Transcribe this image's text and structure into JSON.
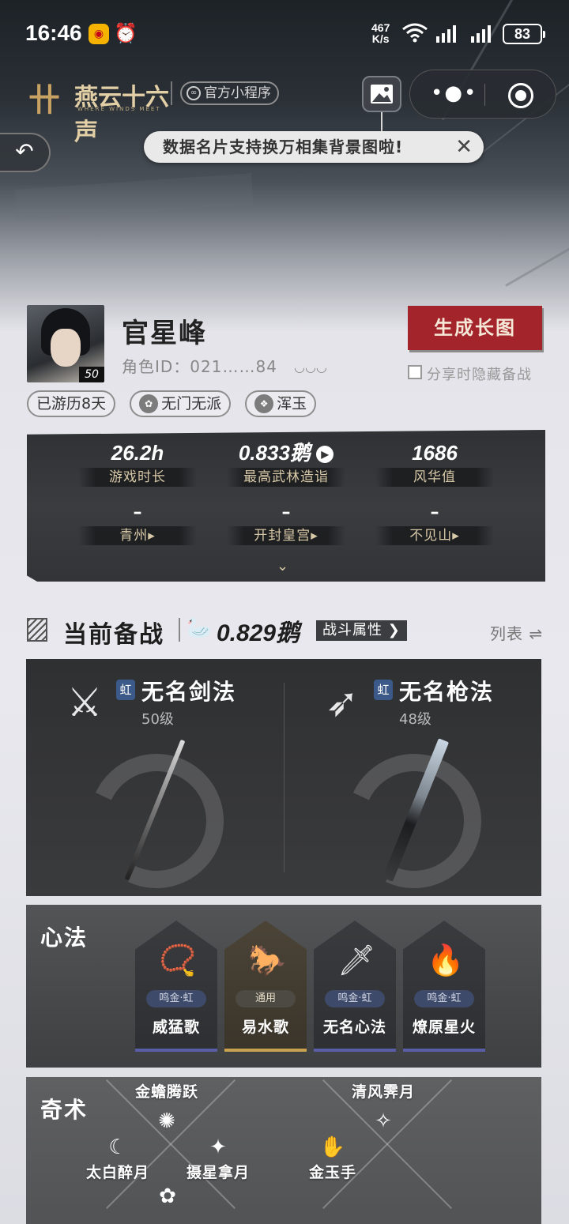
{
  "status_bar": {
    "time": "16:46",
    "speed_value": "467",
    "speed_unit": "K/s",
    "battery": "83"
  },
  "title_bar": {
    "logo_text": "燕云十六声",
    "logo_sub": "WHERE WINDS MEET",
    "official_tag": "官方小程序"
  },
  "tip": {
    "text": "数据名片支持换万相集背景图啦!"
  },
  "profile": {
    "name": "官星峰",
    "role_id": "角色ID：021……84",
    "level": "50",
    "generate_button": "生成长图",
    "hide_label": "分享时隐藏备战",
    "tags": [
      "已游历8天",
      "无门无派",
      "浑玉"
    ]
  },
  "stats": {
    "play_time": "26.2h",
    "play_time_label": "游戏时长",
    "max_score": "0.833鹅",
    "max_score_label": "最高武林造诣",
    "fenghua": "1686",
    "fenghua_label": "风华值",
    "dash": "–",
    "region1": "青州",
    "region2": "开封皇宫",
    "region3": "不见山"
  },
  "battle": {
    "title": "当前备战",
    "score": "0.829鹅",
    "attr_button": "战斗属性",
    "list_button": "列表"
  },
  "weapons": [
    {
      "rank": "虹",
      "name": "无名剑法",
      "level": "50级"
    },
    {
      "rank": "虹",
      "name": "无名枪法",
      "level": "48级"
    }
  ],
  "xinfa": {
    "title": "心法",
    "cards": [
      {
        "badge": "鸣金·虹",
        "name": "威猛歌"
      },
      {
        "badge": "通用",
        "name": "易水歌"
      },
      {
        "badge": "鸣金·虹",
        "name": "无名心法"
      },
      {
        "badge": "鸣金·虹",
        "name": "燎原星火"
      }
    ]
  },
  "qishu": {
    "title": "奇术",
    "skills": [
      "金蟾腾跃",
      "太白醉月",
      "摄星拿月",
      "清风霁月",
      "金玉手"
    ]
  },
  "colors": {
    "accent_red": "#a3242a",
    "gold_text": "#d8c9a8",
    "panel_dark": "#2f3032"
  }
}
